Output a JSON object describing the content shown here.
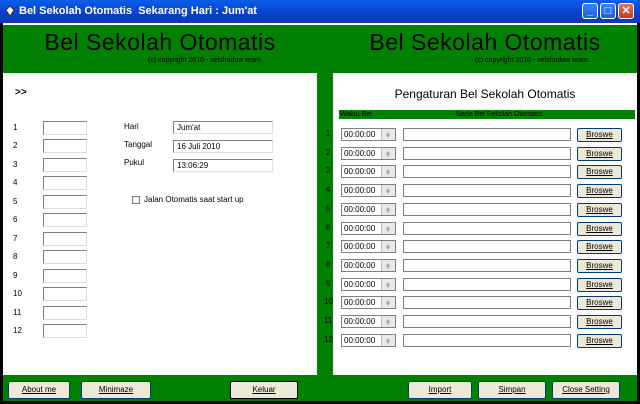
{
  "window": {
    "title": "Bel Sekolah Otomatis  Sekarang Hari : Jum'at"
  },
  "left": {
    "header_title": "Bel Sekolah Otomatis",
    "copyright": "(c) copyright 2010 - velshadow team",
    "arrows": ">>",
    "numbers": [
      "1",
      "2",
      "3",
      "4",
      "5",
      "6",
      "7",
      "8",
      "9",
      "10",
      "11",
      "12"
    ],
    "hari_label": "Hari",
    "hari_value": "Jum'at",
    "tanggal_label": "Tanggal",
    "tanggal_value": "16 Juli 2010",
    "pukul_label": "Pukul",
    "pukul_value": "13:06:29",
    "autostart_label": "Jalan Otomatis saat start up"
  },
  "right": {
    "header_title": "Bel Sekolah Otomatis",
    "copyright": "(c) copyright 2010 - velshadow team",
    "settings_title": "Pengaturan Bel Sekolah Otomatis",
    "col_waktu": "Waktu Bel",
    "col_nada": "Nada Bel Sekolah Otomatis",
    "rows": [
      {
        "no": "1",
        "time": "00:00:00",
        "browse": "Broswe"
      },
      {
        "no": "2",
        "time": "00:00:00",
        "browse": "Broswe"
      },
      {
        "no": "3",
        "time": "00:00:00",
        "browse": "Broswe"
      },
      {
        "no": "4",
        "time": "00:00:00",
        "browse": "Broswe"
      },
      {
        "no": "5",
        "time": "00:00:00",
        "browse": "Broswe"
      },
      {
        "no": "6",
        "time": "00:00:00",
        "browse": "Broswe"
      },
      {
        "no": "7",
        "time": "00:00:00",
        "browse": "Broswe"
      },
      {
        "no": "8",
        "time": "00:00:00",
        "browse": "Broswe"
      },
      {
        "no": "9",
        "time": "00:00:00",
        "browse": "Broswe"
      },
      {
        "no": "10",
        "time": "00:00:00",
        "browse": "Broswe"
      },
      {
        "no": "11",
        "time": "00:00:00",
        "browse": "Broswe"
      },
      {
        "no": "12",
        "time": "00:00:00",
        "browse": "Broswe"
      }
    ]
  },
  "buttons": {
    "about": "About me",
    "minimize": "Minimaze",
    "keluar": "Keluar",
    "import": "Import",
    "simpan": "Simpan",
    "close_setting": "Close Setting"
  },
  "colors": {
    "green": "#008000",
    "titlebar": "#0a46d6"
  }
}
